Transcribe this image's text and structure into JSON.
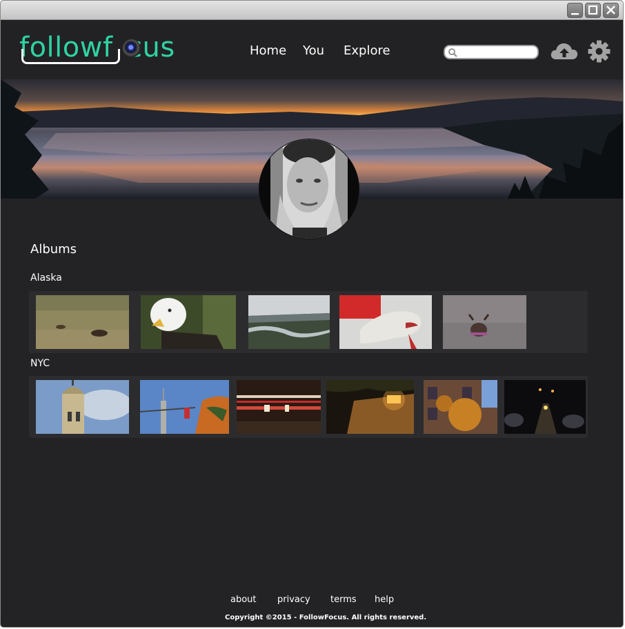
{
  "app": {
    "logo_text": "followf cus"
  },
  "window_controls": {
    "minimize": "minimize",
    "maximize": "maximize",
    "close": "close"
  },
  "nav": {
    "items": [
      {
        "label": "Home"
      },
      {
        "label": "You"
      },
      {
        "label": "Explore"
      }
    ]
  },
  "search": {
    "value": "",
    "icon": "search-icon"
  },
  "header_actions": {
    "upload_icon": "cloud-upload-icon",
    "settings_icon": "gear-icon"
  },
  "albums": {
    "heading": "Albums",
    "list": [
      {
        "title": "Alaska",
        "photos": [
          "caribou on tundra",
          "bald eagle",
          "river valley",
          "husky dog",
          "moose in brush"
        ]
      },
      {
        "title": "NYC",
        "photos": [
          "church tower",
          "empire state building",
          "light trails",
          "lamp on brick wall",
          "autumn building facade",
          "street at night"
        ]
      }
    ]
  },
  "footer": {
    "links": [
      {
        "label": "about"
      },
      {
        "label": "privacy"
      },
      {
        "label": "terms"
      },
      {
        "label": "help"
      }
    ],
    "copyright": "Copyright ©2015 - FollowFocus. All rights reserved."
  },
  "colors": {
    "accent": "#2fd3a3",
    "background": "#232325",
    "strip": "#2c2c2e"
  }
}
